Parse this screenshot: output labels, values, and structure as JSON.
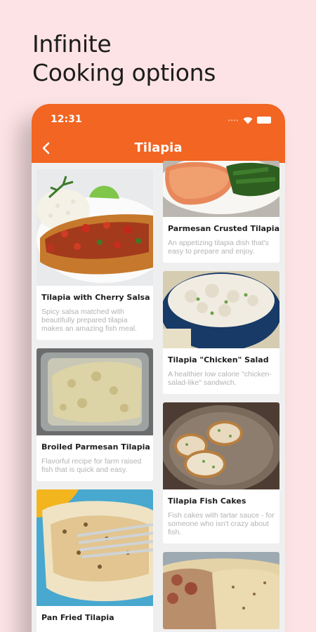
{
  "promo": {
    "line1": "Infinite",
    "line2": "Cooking options"
  },
  "status_bar": {
    "time": "12:31"
  },
  "app_bar": {
    "title": "Tilapia",
    "back_icon": "chevron-left-icon"
  },
  "recipes_left": [
    {
      "title": "Tilapia with Cherry Salsa",
      "description": "Spicy salsa matched with beautifully prepared tilapia makes an amazing fish meal."
    },
    {
      "title": "Broiled Parmesan Tilapia",
      "description": "Flavorful recipe for farm raised fish that is quick and easy."
    },
    {
      "title": "Pan Fried Tilapia",
      "description": ""
    }
  ],
  "recipes_right": [
    {
      "title": "Parmesan Crusted Tilapia",
      "description": "An appetizing tilapia dish that's easy to prepare and enjoy."
    },
    {
      "title": "Tilapia \"Chicken\" Salad",
      "description": "A healthier low calorie \"chicken-salad-like\" sandwich."
    },
    {
      "title": "Tilapia Fish Cakes",
      "description": "Fish cakes with tartar sauce - for someone who isn't crazy about fish."
    },
    {
      "title": "",
      "description": ""
    }
  ],
  "colors": {
    "accent": "#f26522",
    "background": "#fde3e5"
  }
}
